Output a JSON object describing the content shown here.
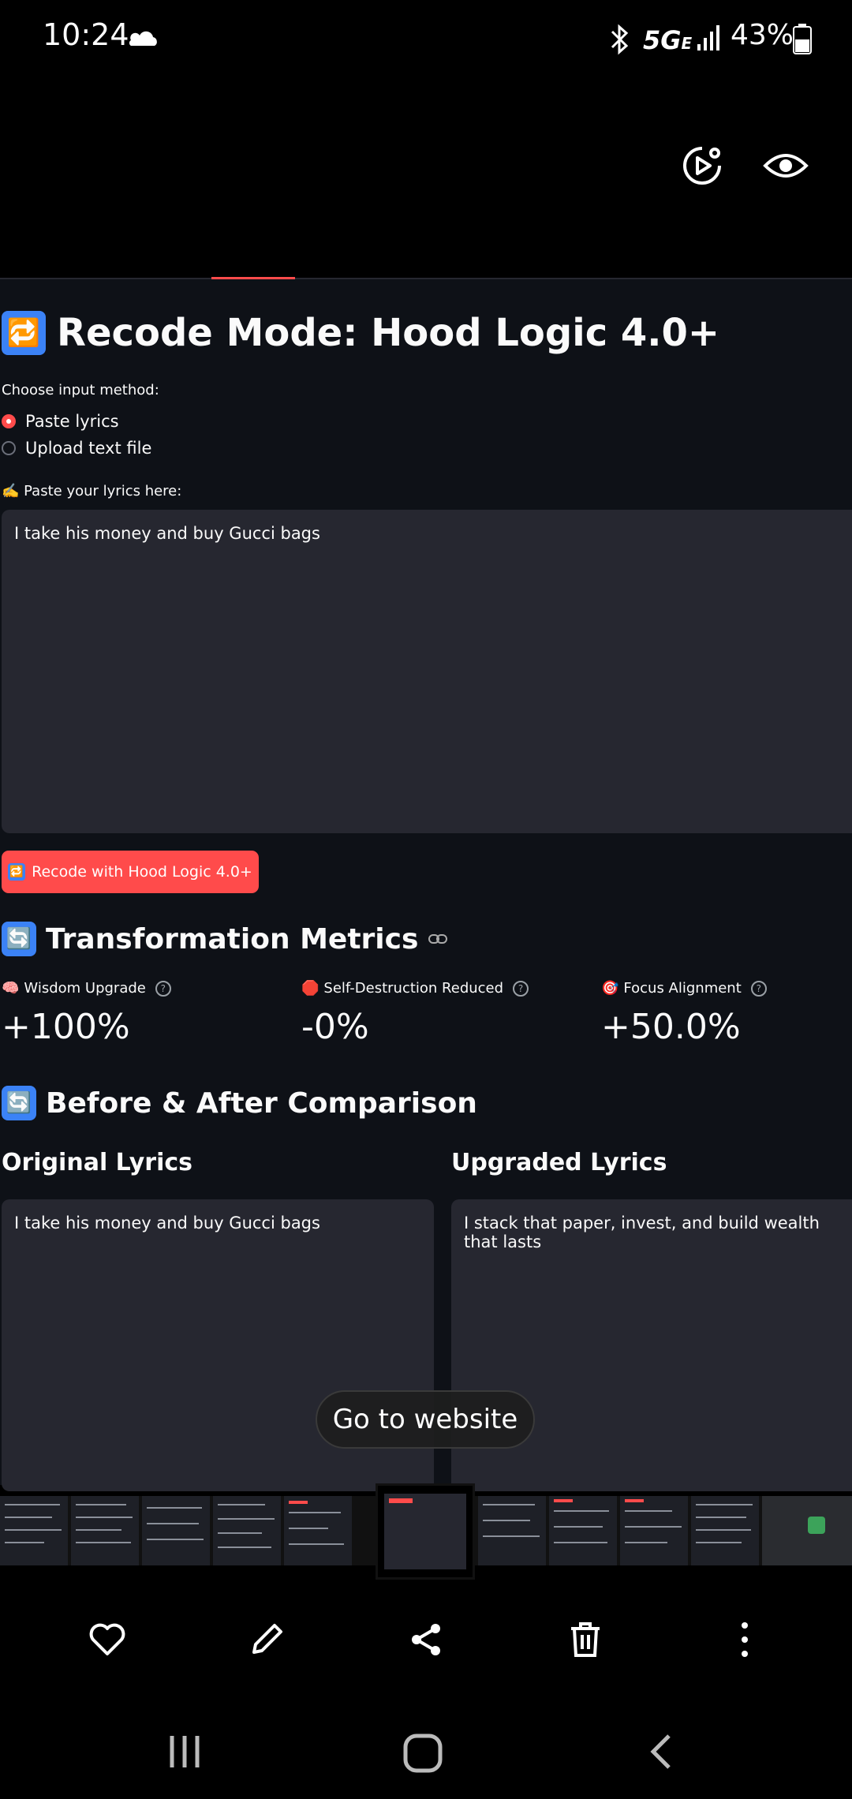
{
  "status_bar": {
    "time": "10:24",
    "network": "5G",
    "network_suffix": "E",
    "battery": "43%"
  },
  "app": {
    "title": "Recode Mode: Hood Logic 4.0+",
    "title_emoji": "🔁",
    "input_method_label": "Choose input method:",
    "radio_options": [
      {
        "label": "Paste lyrics",
        "selected": true
      },
      {
        "label": "Upload text file",
        "selected": false
      }
    ],
    "paste_label": "✍️ Paste your lyrics here:",
    "lyrics_input_value": "I take his money and buy Gucci bags",
    "recode_button_label": "Recode with Hood Logic 4.0+",
    "recode_button_emoji": "🔁",
    "metrics_title": "Transformation Metrics",
    "metrics_emoji": "🔄",
    "metrics": [
      {
        "emoji": "🧠",
        "label": "Wisdom Upgrade",
        "value": "+100%"
      },
      {
        "emoji": "🛑",
        "label": "Self-Destruction Reduced",
        "value": "-0%"
      },
      {
        "emoji": "🎯",
        "label": "Focus Alignment",
        "value": "+50.0%"
      }
    ],
    "comparison_title": "Before & After Comparison",
    "comparison_emoji": "🔄",
    "original_heading": "Original Lyrics",
    "original_text": "I take his money and buy Gucci bags",
    "upgraded_heading": "Upgraded Lyrics",
    "upgraded_text": "I stack that paper, invest, and build wealth that lasts"
  },
  "overlay": {
    "go_to_website": "Go to website"
  },
  "colors": {
    "accent": "#ff4b4b",
    "app_bg": "#0e1117",
    "input_bg": "#262730"
  },
  "icons": {
    "top_actions": [
      "motion-photo-icon",
      "eye-icon"
    ],
    "bottom_actions": [
      "heart-icon",
      "edit-icon",
      "share-icon",
      "delete-icon",
      "more-icon"
    ],
    "nav": [
      "recents-icon",
      "home-icon",
      "back-icon"
    ]
  }
}
